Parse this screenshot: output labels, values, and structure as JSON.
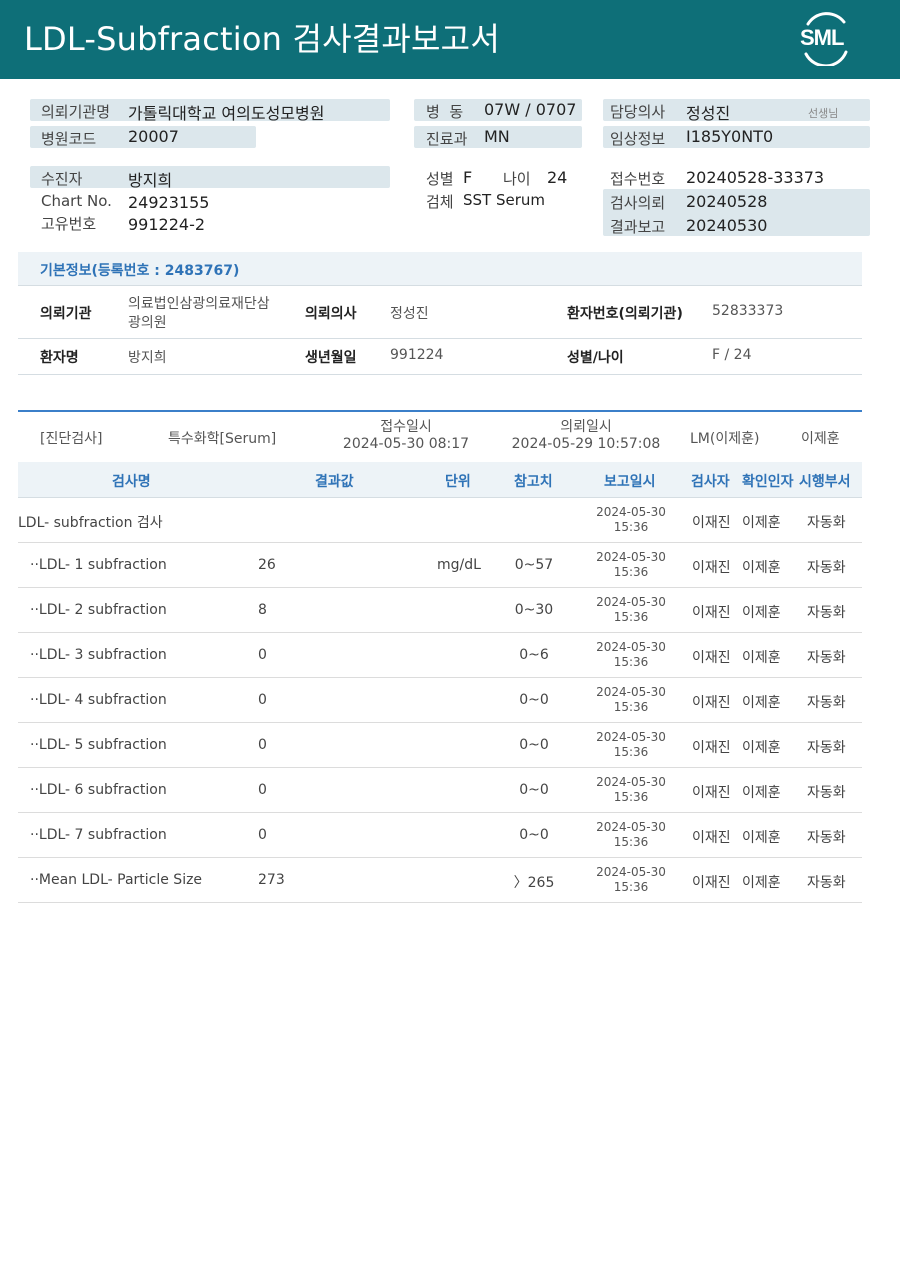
{
  "header": {
    "title": "LDL-Subfraction 검사결과보고서",
    "logo_text": "SML",
    "bg_color": "#0e6f78"
  },
  "request": {
    "institution_label": "의뢰기관명",
    "institution_value": "가톨릭대학교 여의도성모병원",
    "hospital_code_label": "병원코드",
    "hospital_code_value": "20007",
    "ward_label": "병  동",
    "ward_value": "07W / 0707",
    "dept_label": "진료과",
    "dept_value": "MN",
    "doctor_label": "담당의사",
    "doctor_value": "정성진",
    "doctor_suffix": "선생님",
    "clinical_label": "임상정보",
    "clinical_value": "I185Y0NT0"
  },
  "patient": {
    "name_label": "수진자",
    "name_value": "방지희",
    "chart_label": "Chart No.",
    "chart_value": "24923155",
    "unique_label": "고유번호",
    "unique_value": "991224-2",
    "sex_label": "성별",
    "sex_value": "F",
    "age_label": "나이",
    "age_value": "24",
    "specimen_label": "검체",
    "specimen_value": "SST Serum",
    "receipt_label": "접수번호",
    "receipt_value": "20240528-33373",
    "test_request_label": "검사의뢰",
    "test_request_value": "20240528",
    "result_report_label": "결과보고",
    "result_report_value": "20240530"
  },
  "basic_info": {
    "heading": "기본정보(등록번호 : 2483767)",
    "row1": {
      "k1": "의뢰기관",
      "v1_line1": "의료법인삼광의료재단삼",
      "v1_line2": "광의원",
      "k2": "의뢰의사",
      "v2": "정성진",
      "k3": "환자번호(의뢰기관)",
      "v3": "52833373"
    },
    "row2": {
      "k1": "환자명",
      "v1": "방지희",
      "k2": "생년월일",
      "v2": "991224",
      "k3": "성별/나이",
      "v3": "F / 24"
    }
  },
  "diagnosis": {
    "category": "[진단검사]",
    "type": "특수화학[Serum]",
    "receipt_label": "접수일시",
    "receipt_time": "2024-05-30 08:17",
    "request_label": "의뢰일시",
    "request_time": "2024-05-29 10:57:08",
    "lm": "LM(이제훈)",
    "lm_name": "이제훈"
  },
  "table": {
    "headers": {
      "name": "검사명",
      "result": "결과값",
      "unit": "단위",
      "ref": "참고치",
      "report": "보고일시",
      "tester": "검사자",
      "verifier": "확인인자",
      "dept": "시행부서"
    },
    "rows": [
      {
        "name": "LDL- subfraction 검사",
        "result": "",
        "unit": "",
        "ref": "",
        "date": "2024-05-30",
        "time": "15:36",
        "tester": "이재진",
        "verifier": "이제훈",
        "dept": "자동화"
      },
      {
        "name": "··LDL- 1 subfraction",
        "result": "26",
        "unit": "mg/dL",
        "ref": "0~57",
        "date": "2024-05-30",
        "time": "15:36",
        "tester": "이재진",
        "verifier": "이제훈",
        "dept": "자동화"
      },
      {
        "name": "··LDL- 2 subfraction",
        "result": "8",
        "unit": "",
        "ref": "0~30",
        "date": "2024-05-30",
        "time": "15:36",
        "tester": "이재진",
        "verifier": "이제훈",
        "dept": "자동화"
      },
      {
        "name": "··LDL- 3 subfraction",
        "result": "0",
        "unit": "",
        "ref": "0~6",
        "date": "2024-05-30",
        "time": "15:36",
        "tester": "이재진",
        "verifier": "이제훈",
        "dept": "자동화"
      },
      {
        "name": "··LDL- 4 subfraction",
        "result": "0",
        "unit": "",
        "ref": "0~0",
        "date": "2024-05-30",
        "time": "15:36",
        "tester": "이재진",
        "verifier": "이제훈",
        "dept": "자동화"
      },
      {
        "name": "··LDL- 5 subfraction",
        "result": "0",
        "unit": "",
        "ref": "0~0",
        "date": "2024-05-30",
        "time": "15:36",
        "tester": "이재진",
        "verifier": "이제훈",
        "dept": "자동화"
      },
      {
        "name": "··LDL- 6 subfraction",
        "result": "0",
        "unit": "",
        "ref": "0~0",
        "date": "2024-05-30",
        "time": "15:36",
        "tester": "이재진",
        "verifier": "이제훈",
        "dept": "자동화"
      },
      {
        "name": "··LDL- 7 subfraction",
        "result": "0",
        "unit": "",
        "ref": "0~0",
        "date": "2024-05-30",
        "time": "15:36",
        "tester": "이재진",
        "verifier": "이제훈",
        "dept": "자동화"
      },
      {
        "name": "··Mean LDL- Particle Size",
        "result": "273",
        "unit": "",
        "ref": "〉265",
        "date": "2024-05-30",
        "time": "15:36",
        "tester": "이재진",
        "verifier": "이제훈",
        "dept": "자동화"
      }
    ]
  }
}
